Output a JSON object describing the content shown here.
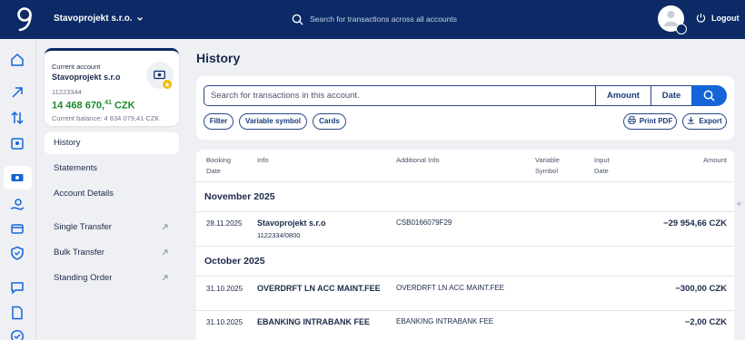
{
  "topbar": {
    "company": "Stavoprojekt s.r.o.",
    "search_placeholder": "Search for transactions across all accounts",
    "logout_label": "Logout"
  },
  "account": {
    "type": "Current account",
    "name": "Stavoprojekt s.r.o",
    "number": "11223344",
    "balance_main": "14 468 670,",
    "balance_cents": "41",
    "balance_currency": " CZK",
    "current_balance": "Current balance: 4 834 079,41 CZK"
  },
  "sidebar": {
    "items": [
      {
        "label": "History"
      },
      {
        "label": "Statements"
      },
      {
        "label": "Account Details"
      },
      {
        "label": "Single Transfer"
      },
      {
        "label": "Bulk Transfer"
      },
      {
        "label": "Standing Order"
      }
    ]
  },
  "main": {
    "title": "History",
    "search_placeholder": "Search for transactions in this account.",
    "amount_label": "Amount",
    "date_label": "Date",
    "chips": [
      "Filter",
      "Variable symbol",
      "Cards"
    ],
    "print_label": "Print PDF",
    "export_label": "Export"
  },
  "table": {
    "headers": {
      "booking_date": "Booking\nDate",
      "info": "Info",
      "additional": "Additional Info",
      "variable": "Variable\nSymbol",
      "input_date": "Input\nDate",
      "amount": "Amount"
    },
    "groups": [
      {
        "month": "November 2025",
        "rows": [
          {
            "date": "28.11.2025",
            "info": "Stavoprojekt s.r.o",
            "info_sub": "1122334/0800",
            "additional": "CSB0166079F29",
            "amount": "−29 954,66 CZK"
          }
        ]
      },
      {
        "month": "October 2025",
        "rows": [
          {
            "date": "31.10.2025",
            "info": "OVERDRFT LN ACC MAINT.FEE",
            "additional": "OVERDRFT LN ACC MAINT.FEE",
            "amount": "−300,00 CZK"
          },
          {
            "date": "31.10.2025",
            "info": "EBANKING INTRABANK FEE",
            "additional": "EBANKING INTRABANK FEE",
            "amount": "−2,00 CZK"
          }
        ]
      }
    ]
  },
  "colors": {
    "navy": "#0b2a66",
    "accent_blue": "#1565d8",
    "balance_green": "#1a8a2e"
  }
}
